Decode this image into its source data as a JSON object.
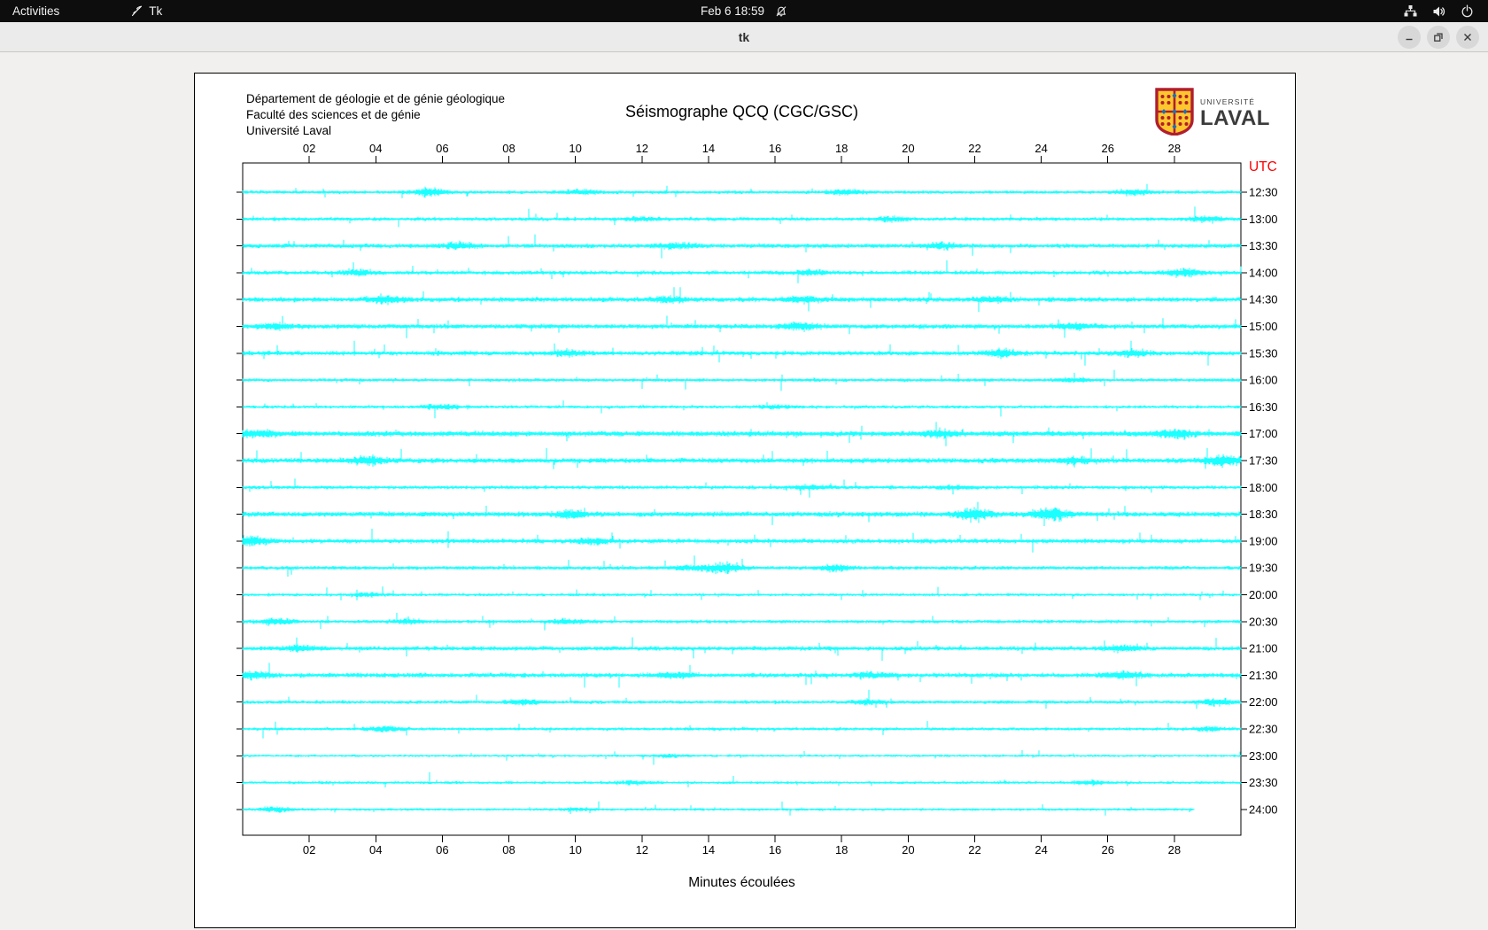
{
  "colors": {
    "trace": "#00ffff",
    "utc_label": "#ff0000",
    "axis": "#000000",
    "topbar_bg": "#0d0d0d",
    "titlebar_bg": "#ebebeb",
    "window_bg": "#f1f0ee",
    "canvas_bg": "#ffffff",
    "logo_red": "#b01e2f",
    "logo_gold": "#ffc72c",
    "logo_blue": "#1f6fb5",
    "logo_text": "#3c3c3c"
  },
  "top_bar": {
    "activities_label": "Activities",
    "app_name": "Tk",
    "clock": "Feb 6  18:59"
  },
  "window": {
    "title": "tk"
  },
  "canvas": {
    "header_line1": "Département de géologie et de génie géologique",
    "header_line2": "Faculté des sciences et de génie",
    "header_line3": "Université Laval",
    "title": "Séismographe QCQ (CGC/GSC)",
    "logo": {
      "line1": "UNIVERSITÉ",
      "line2": "LAVAL"
    }
  },
  "chart_data": {
    "type": "line",
    "title": "Séismographe QCQ (CGC/GSC)",
    "xlabel": "Minutes écoulées",
    "right_axis_label": "UTC",
    "x_range": [
      0,
      30
    ],
    "x_ticks": [
      {
        "m": 2,
        "label": "02"
      },
      {
        "m": 4,
        "label": "04"
      },
      {
        "m": 6,
        "label": "06"
      },
      {
        "m": 8,
        "label": "08"
      },
      {
        "m": 10,
        "label": "10"
      },
      {
        "m": 12,
        "label": "12"
      },
      {
        "m": 14,
        "label": "14"
      },
      {
        "m": 16,
        "label": "16"
      },
      {
        "m": 18,
        "label": "18"
      },
      {
        "m": 20,
        "label": "20"
      },
      {
        "m": 22,
        "label": "22"
      },
      {
        "m": 24,
        "label": "24"
      },
      {
        "m": 26,
        "label": "26"
      },
      {
        "m": 28,
        "label": "28"
      }
    ],
    "trace_interval_minutes": 30,
    "traces": [
      {
        "label": "12:30",
        "amp": 1.1,
        "end_min": 30,
        "events": [
          {
            "min": 5.6,
            "mag": 3.0
          },
          {
            "min": 10.2,
            "mag": 2.0
          },
          {
            "min": 18.1,
            "mag": 2.4
          },
          {
            "min": 26.8,
            "mag": 2.4
          }
        ]
      },
      {
        "label": "13:00",
        "amp": 1.15,
        "end_min": 30,
        "events": [
          {
            "min": 12.0,
            "mag": 1.8
          },
          {
            "min": 19.5,
            "mag": 2.0
          },
          {
            "min": 29.0,
            "mag": 2.4
          }
        ]
      },
      {
        "label": "13:30",
        "amp": 1.4,
        "end_min": 30,
        "events": [
          {
            "min": 6.5,
            "mag": 2.0
          },
          {
            "min": 13.0,
            "mag": 2.0
          },
          {
            "min": 21.0,
            "mag": 2.0
          }
        ]
      },
      {
        "label": "14:00",
        "amp": 1.25,
        "end_min": 30,
        "events": [
          {
            "min": 3.5,
            "mag": 2.2
          },
          {
            "min": 17.0,
            "mag": 2.0
          },
          {
            "min": 28.3,
            "mag": 2.6
          }
        ]
      },
      {
        "label": "14:30",
        "amp": 1.5,
        "end_min": 30,
        "events": [
          {
            "min": 4.3,
            "mag": 2.4
          },
          {
            "min": 12.8,
            "mag": 2.0
          },
          {
            "min": 16.8,
            "mag": 2.0
          },
          {
            "min": 22.5,
            "mag": 2.0
          }
        ]
      },
      {
        "label": "15:00",
        "amp": 1.5,
        "end_min": 30,
        "events": [
          {
            "min": 1.0,
            "mag": 2.0
          },
          {
            "min": 16.8,
            "mag": 2.2
          },
          {
            "min": 25.0,
            "mag": 2.0
          }
        ]
      },
      {
        "label": "15:30",
        "amp": 1.45,
        "end_min": 30,
        "events": [
          {
            "min": 9.8,
            "mag": 2.0
          },
          {
            "min": 22.8,
            "mag": 2.4
          },
          {
            "min": 26.7,
            "mag": 2.2
          }
        ]
      },
      {
        "label": "16:00",
        "amp": 1.1,
        "end_min": 30,
        "events": [
          {
            "min": 25.0,
            "mag": 2.0
          }
        ]
      },
      {
        "label": "16:30",
        "amp": 1.0,
        "end_min": 30,
        "events": [
          {
            "min": 6.0,
            "mag": 2.4
          },
          {
            "min": 16.0,
            "mag": 1.8
          }
        ]
      },
      {
        "label": "17:00",
        "amp": 1.7,
        "end_min": 30,
        "events": [
          {
            "min": 0.5,
            "mag": 2.0
          },
          {
            "min": 21.0,
            "mag": 2.0
          },
          {
            "min": 28.0,
            "mag": 2.4
          }
        ]
      },
      {
        "label": "17:30",
        "amp": 1.6,
        "end_min": 30,
        "events": [
          {
            "min": 3.8,
            "mag": 2.4
          },
          {
            "min": 25.0,
            "mag": 2.0
          },
          {
            "min": 29.5,
            "mag": 2.8
          }
        ]
      },
      {
        "label": "18:00",
        "amp": 1.15,
        "end_min": 30,
        "events": [
          {
            "min": 17.0,
            "mag": 2.0
          },
          {
            "min": 21.5,
            "mag": 2.0
          }
        ]
      },
      {
        "label": "18:30",
        "amp": 1.6,
        "end_min": 30,
        "events": [
          {
            "min": 9.9,
            "mag": 2.0
          },
          {
            "min": 22.0,
            "mag": 3.0
          },
          {
            "min": 24.3,
            "mag": 3.3
          }
        ]
      },
      {
        "label": "19:00",
        "amp": 1.45,
        "end_min": 30,
        "events": [
          {
            "min": 0.3,
            "mag": 2.8
          },
          {
            "min": 10.5,
            "mag": 2.0
          }
        ]
      },
      {
        "label": "19:30",
        "amp": 1.2,
        "end_min": 30,
        "events": [
          {
            "min": 13.5,
            "mag": 2.0
          },
          {
            "min": 14.5,
            "mag": 3.4
          },
          {
            "min": 17.8,
            "mag": 2.4
          }
        ]
      },
      {
        "label": "20:00",
        "amp": 0.95,
        "end_min": 30,
        "events": [
          {
            "min": 3.8,
            "mag": 2.0
          }
        ]
      },
      {
        "label": "20:30",
        "amp": 1.1,
        "end_min": 30,
        "events": [
          {
            "min": 1.0,
            "mag": 2.4
          },
          {
            "min": 5.0,
            "mag": 2.0
          },
          {
            "min": 9.8,
            "mag": 2.0
          }
        ]
      },
      {
        "label": "21:00",
        "amp": 1.35,
        "end_min": 30,
        "events": [
          {
            "min": 1.8,
            "mag": 2.0
          },
          {
            "min": 26.5,
            "mag": 2.2
          }
        ]
      },
      {
        "label": "21:30",
        "amp": 1.45,
        "end_min": 30,
        "events": [
          {
            "min": 0.3,
            "mag": 2.4
          },
          {
            "min": 13.0,
            "mag": 2.0
          },
          {
            "min": 19.0,
            "mag": 2.0
          },
          {
            "min": 26.5,
            "mag": 2.4
          }
        ]
      },
      {
        "label": "22:00",
        "amp": 1.1,
        "end_min": 30,
        "events": [
          {
            "min": 8.5,
            "mag": 2.4
          },
          {
            "min": 18.8,
            "mag": 2.0
          },
          {
            "min": 29.3,
            "mag": 2.6
          }
        ]
      },
      {
        "label": "22:30",
        "amp": 1.0,
        "end_min": 30,
        "events": [
          {
            "min": 4.3,
            "mag": 2.4
          },
          {
            "min": 29.0,
            "mag": 2.0
          }
        ]
      },
      {
        "label": "23:00",
        "amp": 0.8,
        "end_min": 30,
        "events": [
          {
            "min": 12.8,
            "mag": 2.0
          }
        ]
      },
      {
        "label": "23:30",
        "amp": 0.9,
        "end_min": 30,
        "events": [
          {
            "min": 11.8,
            "mag": 2.0
          },
          {
            "min": 25.5,
            "mag": 2.2
          }
        ]
      },
      {
        "label": "24:00",
        "amp": 0.85,
        "end_min": 28.6,
        "events": [
          {
            "min": 1.0,
            "mag": 2.4
          },
          {
            "min": 10.0,
            "mag": 2.0
          }
        ]
      }
    ]
  }
}
